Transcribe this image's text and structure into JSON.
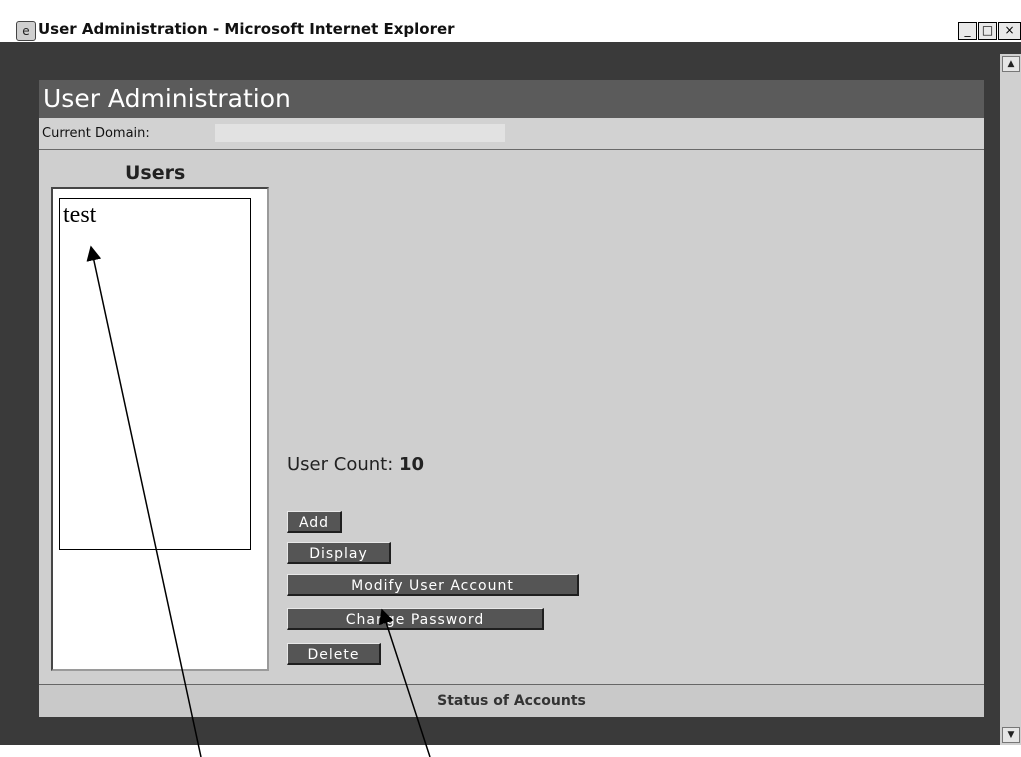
{
  "window": {
    "title": "User Administration - Microsoft Internet Explorer",
    "icon": "ie-icon",
    "controls": {
      "minimize": "_",
      "maximize": "□",
      "close": "×"
    }
  },
  "app": {
    "title": "User Administration",
    "domain_label": "Current Domain:",
    "users_heading": "Users",
    "users": [
      "test"
    ],
    "user_count_label": "User Count:",
    "user_count": "10",
    "buttons": {
      "add": "Add",
      "display": "Display",
      "modify": "Modify User Account",
      "change_password": "Change Password",
      "delete": "Delete"
    },
    "status_label": "Status of Accounts"
  },
  "scrollbar": {
    "up": "▲",
    "down": "▼"
  },
  "colors": {
    "header": "#5b5b5b",
    "button": "#555555",
    "panel": "#cfcfcf"
  }
}
